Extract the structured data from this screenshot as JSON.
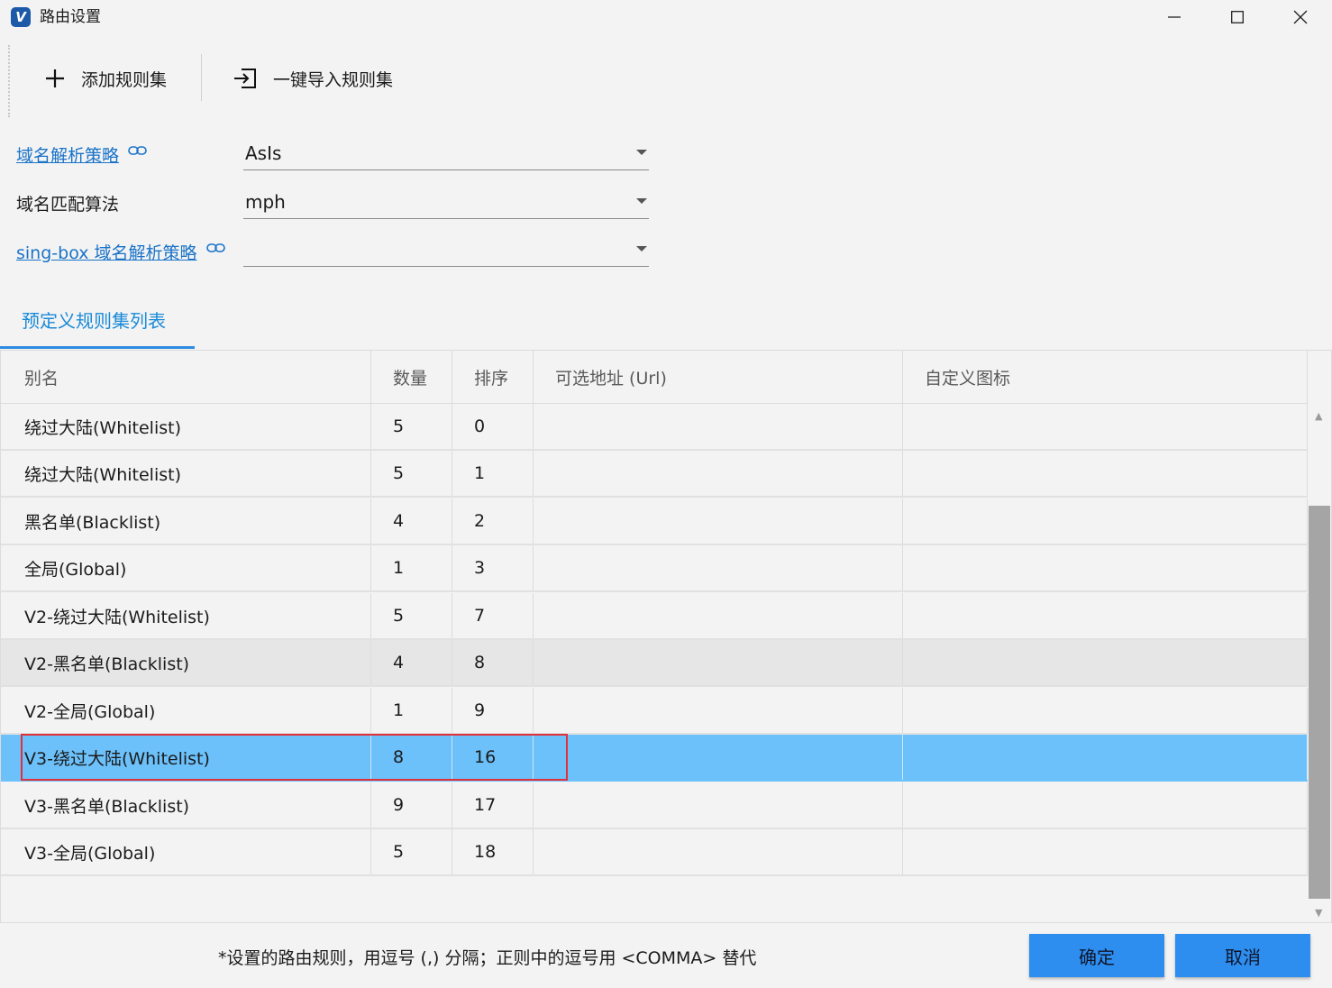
{
  "window": {
    "title": "路由设置",
    "icon": "v2rayn-app-icon"
  },
  "toolbar": {
    "add_label": "添加规则集",
    "import_label": "一键导入规则集"
  },
  "form": {
    "domain_strategy": {
      "label": "域名解析策略",
      "value": "AsIs"
    },
    "domain_matcher": {
      "label": "域名匹配算法",
      "value": "mph"
    },
    "singbox_strategy": {
      "label": "sing-box 域名解析策略",
      "value": ""
    }
  },
  "tab": {
    "label": "预定义规则集列表"
  },
  "table": {
    "columns": [
      "别名",
      "数量",
      "排序",
      "可选地址 (Url)",
      "自定义图标"
    ],
    "rows": [
      {
        "alias": "绕过大陆(Whitelist)",
        "count": "5",
        "order": "0",
        "url": "",
        "icon": ""
      },
      {
        "alias": "绕过大陆(Whitelist)",
        "count": "5",
        "order": "1",
        "url": "",
        "icon": ""
      },
      {
        "alias": "黑名单(Blacklist)",
        "count": "4",
        "order": "2",
        "url": "",
        "icon": ""
      },
      {
        "alias": "全局(Global)",
        "count": "1",
        "order": "3",
        "url": "",
        "icon": ""
      },
      {
        "alias": "V2-绕过大陆(Whitelist)",
        "count": "5",
        "order": "7",
        "url": "",
        "icon": ""
      },
      {
        "alias": "V2-黑名单(Blacklist)",
        "count": "4",
        "order": "8",
        "url": "",
        "icon": ""
      },
      {
        "alias": "V2-全局(Global)",
        "count": "1",
        "order": "9",
        "url": "",
        "icon": ""
      },
      {
        "alias": "V3-绕过大陆(Whitelist)",
        "count": "8",
        "order": "16",
        "url": "",
        "icon": ""
      },
      {
        "alias": "V3-黑名单(Blacklist)",
        "count": "9",
        "order": "17",
        "url": "",
        "icon": ""
      },
      {
        "alias": "V3-全局(Global)",
        "count": "5",
        "order": "18",
        "url": "",
        "icon": ""
      }
    ],
    "selected_row": 7,
    "hover_row": 5
  },
  "footer": {
    "note": "*设置的路由规则，用逗号 (,) 分隔；正则中的逗号用 <COMMA> 替代",
    "ok_label": "确定",
    "cancel_label": "取消"
  },
  "colors": {
    "accent": "#2d8ef0",
    "selection": "#6cc1fb",
    "link": "#1a73c8",
    "highlight_border": "#e0303a"
  }
}
